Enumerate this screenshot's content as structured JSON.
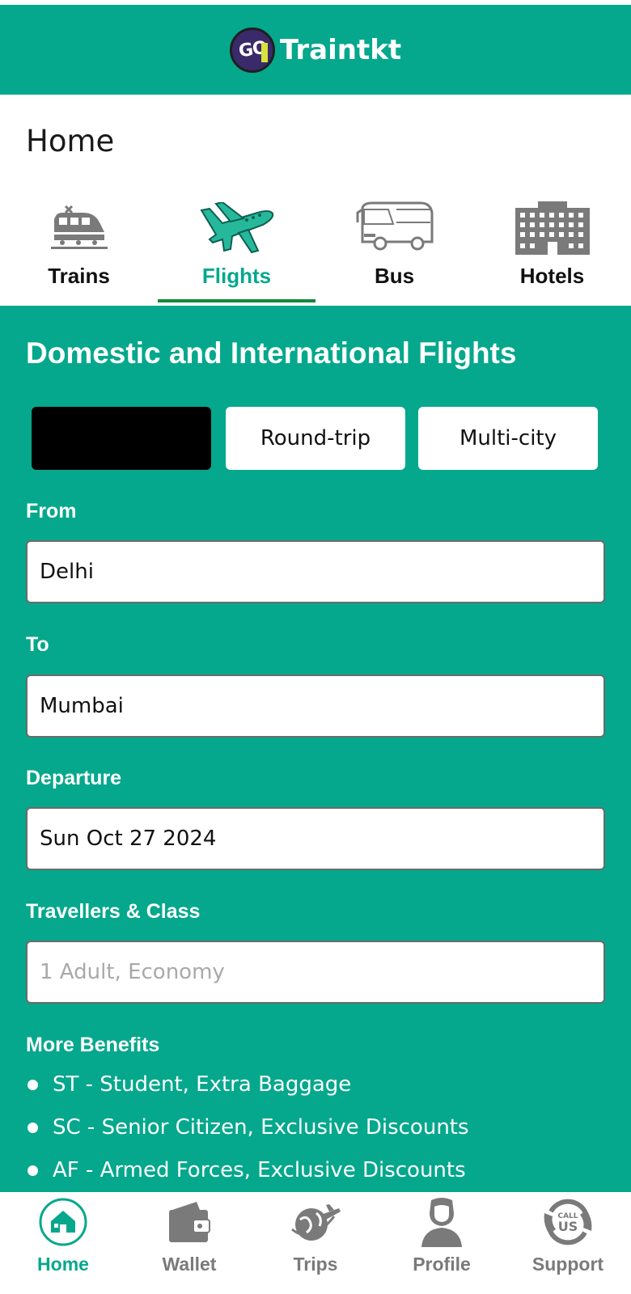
{
  "app": {
    "logo_text": "GO",
    "title": "Traintkt",
    "brand_color": "#05a88c"
  },
  "page": {
    "title": "Home"
  },
  "tabs": [
    {
      "label": "Trains",
      "icon": "train-icon",
      "active": false
    },
    {
      "label": "Flights",
      "icon": "airplane-icon",
      "active": true
    },
    {
      "label": "Bus",
      "icon": "bus-icon",
      "active": false
    },
    {
      "label": "Hotels",
      "icon": "hotel-icon",
      "active": false
    }
  ],
  "flights": {
    "section_title": "Domestic and International Flights",
    "trip_types": [
      {
        "label": "",
        "selected": true,
        "redacted": true
      },
      {
        "label": "Round-trip",
        "selected": false
      },
      {
        "label": "Multi-city",
        "selected": false
      }
    ],
    "from": {
      "label": "From",
      "value": "Delhi"
    },
    "to": {
      "label": "To",
      "value": "Mumbai"
    },
    "departure": {
      "label": "Departure",
      "value": "Sun Oct 27 2024"
    },
    "travellers": {
      "label": "Travellers & Class",
      "placeholder": "1 Adult, Economy"
    },
    "benefits": {
      "title": "More Benefits",
      "items": [
        "ST - Student, Extra Baggage",
        "SC - Senior Citizen, Exclusive Discounts",
        "AF - Armed Forces, Exclusive Discounts"
      ]
    }
  },
  "bottom_nav": [
    {
      "label": "Home",
      "icon": "home-icon",
      "active": true
    },
    {
      "label": "Wallet",
      "icon": "wallet-icon",
      "active": false
    },
    {
      "label": "Trips",
      "icon": "trips-icon",
      "active": false
    },
    {
      "label": "Profile",
      "icon": "profile-icon",
      "active": false
    },
    {
      "label": "Support",
      "icon": "call-us-icon",
      "active": false
    }
  ]
}
